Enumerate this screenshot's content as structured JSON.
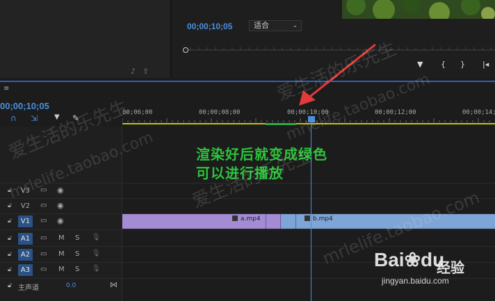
{
  "monitor": {
    "timecode": "00;00;10;05",
    "fit_option": "适合",
    "controls": [
      "mark-in",
      "mark-clip",
      "go-to-in",
      "step-back",
      "step-forward"
    ]
  },
  "timeline": {
    "menu_icon": "hamburger-icon",
    "timecode": "00;00;10;05",
    "ruler_labels": [
      "00;06;00",
      "00;00;08;00",
      "00;00;10;00",
      "00;00;12;00",
      "00;00;14;0"
    ],
    "tracks": {
      "v3": "V3",
      "v2": "V2",
      "v1": "V1",
      "a1": "A1",
      "a2": "A2",
      "a3": "A3"
    },
    "mute_label": "M",
    "solo_label": "S",
    "master": {
      "label": "主声道",
      "value": "0.0"
    },
    "clips": {
      "a": "a.mp4",
      "b": "b.mp4"
    }
  },
  "annotation": {
    "line1": "渲染好后就变成绿色",
    "line2": "可以进行播放"
  },
  "watermarks": {
    "cn": "爱生活的乐先生",
    "url": "mrlelife.taobao.com",
    "baidu_logo": "Bai",
    "baidu_logo_tail": "du",
    "baidu_cn": "经验",
    "baidu_url": "jingyan.baidu.com"
  },
  "colors": {
    "accent": "#4a8fdc",
    "annotation": "#2cc43b",
    "render_bar": "#c9c200",
    "rendered": "#2fa84a",
    "clip_a": "#a48cd4",
    "clip_b": "#7fa4d6"
  }
}
